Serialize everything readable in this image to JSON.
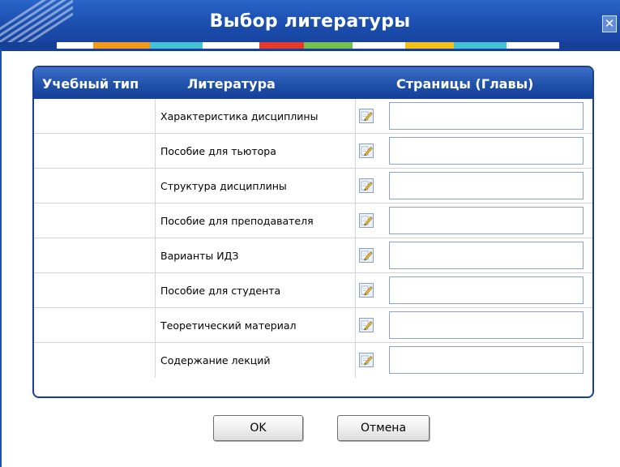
{
  "dialog": {
    "title": "Выбор литературы",
    "colors": {
      "titlebar": "#1c4fb0",
      "table_header": "#163f98",
      "border": "#163f98"
    }
  },
  "table": {
    "headers": {
      "type": "Учебный тип",
      "literature": "Литература",
      "pages": "Страницы (Главы)"
    },
    "rows": [
      {
        "type": "",
        "literature": "Характеристика дисциплины",
        "pages": "",
        "edit_icon": "edit-pencil-icon"
      },
      {
        "type": "",
        "literature": "Пособие для тьютора",
        "pages": "",
        "edit_icon": "edit-pencil-icon"
      },
      {
        "type": "",
        "literature": "Структура дисциплины",
        "pages": "",
        "edit_icon": "edit-pencil-icon"
      },
      {
        "type": "",
        "literature": "Пособие для преподавателя",
        "pages": "",
        "edit_icon": "edit-pencil-icon"
      },
      {
        "type": "",
        "literature": "Варианты ИДЗ",
        "pages": "",
        "edit_icon": "edit-pencil-icon"
      },
      {
        "type": "",
        "literature": "Пособие для студента",
        "pages": "",
        "edit_icon": "edit-pencil-icon"
      },
      {
        "type": "",
        "literature": "Теоретический материал",
        "pages": "",
        "edit_icon": "edit-pencil-icon"
      },
      {
        "type": "",
        "literature": "Содержание лекций",
        "pages": "",
        "edit_icon": "edit-pencil-icon"
      }
    ]
  },
  "buttons": {
    "ok": "OK",
    "cancel": "Отмена"
  }
}
